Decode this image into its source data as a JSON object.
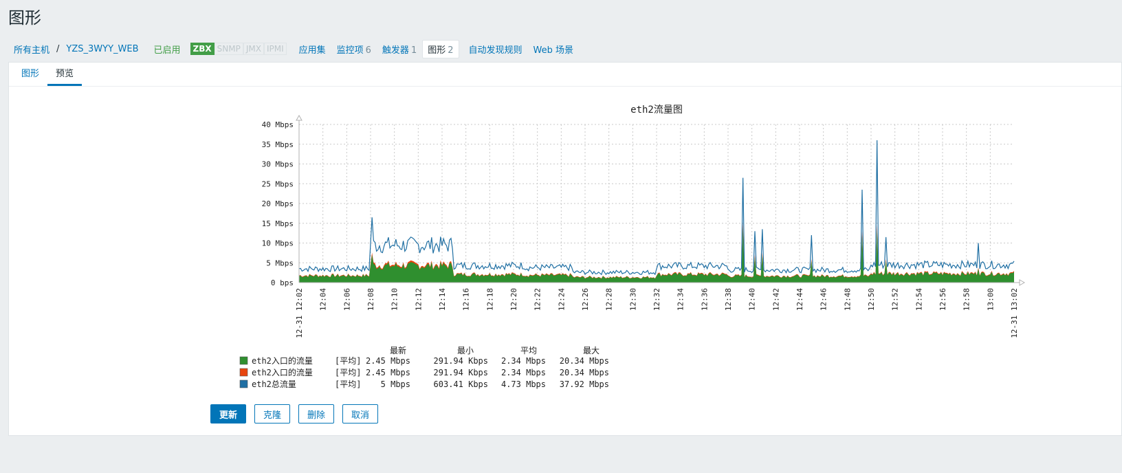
{
  "page": {
    "title": "图形"
  },
  "host_nav": {
    "all_hosts": "所有主机",
    "separator": "/",
    "host_name": "YZS_3WYY_WEB",
    "status": "已启用",
    "badges": [
      {
        "label": "ZBX",
        "active": true
      },
      {
        "label": "SNMP",
        "active": false
      },
      {
        "label": "JMX",
        "active": false
      },
      {
        "label": "IPMI",
        "active": false
      }
    ],
    "applications": "应用集",
    "items": {
      "label": "监控项",
      "count": "6"
    },
    "triggers": {
      "label": "触发器",
      "count": "1"
    },
    "graphs": {
      "label": "图形",
      "count": "2"
    },
    "discovery": "自动发现规则",
    "web": "Web 场景"
  },
  "tabs": [
    {
      "label": "图形",
      "active": false
    },
    {
      "label": "预览",
      "active": true
    }
  ],
  "buttons": {
    "update": "更新",
    "clone": "克隆",
    "delete": "删除",
    "cancel": "取消"
  },
  "chart_data": {
    "type": "area",
    "title": "eth2流量图",
    "y_ticks": [
      "0 bps",
      "5 Mbps",
      "10 Mbps",
      "15 Mbps",
      "20 Mbps",
      "25 Mbps",
      "30 Mbps",
      "35 Mbps",
      "40 Mbps"
    ],
    "ylim": [
      0,
      40
    ],
    "y_unit": "Mbps",
    "x_range_minutes": [
      0,
      60
    ],
    "x_ticks": [
      "12:04",
      "12:06",
      "12:08",
      "12:10",
      "12:12",
      "12:14",
      "12:16",
      "12:18",
      "12:20",
      "12:22",
      "12:24",
      "12:26",
      "12:28",
      "12:30",
      "12:32",
      "12:34",
      "12:36",
      "12:38",
      "12:40",
      "12:42",
      "12:44",
      "12:46",
      "12:48",
      "12:50",
      "12:52",
      "12:54",
      "12:56",
      "12:58",
      "13:00"
    ],
    "x_start_label": "12-31 12:02",
    "x_end_label": "12-31 13:02",
    "grid": true,
    "colors": {
      "in1": "#2f8f2f",
      "in2": "#e8450e",
      "total": "#1f6fa3",
      "highlight": "#e05050"
    },
    "legend_headers": [
      "最新",
      "最小",
      "平均",
      "最大"
    ],
    "series": [
      {
        "name": "eth2入口的流量",
        "func": "[平均]",
        "last": "2.45 Mbps",
        "min": "291.94 Kbps",
        "avg": "2.34 Mbps",
        "max": "20.34 Mbps",
        "color": "#2f8f2f"
      },
      {
        "name": "eth2入口的流量",
        "func": "[平均]",
        "last": "2.45 Mbps",
        "min": "291.94 Kbps",
        "avg": "2.34 Mbps",
        "max": "20.34 Mbps",
        "color": "#e8450e"
      },
      {
        "name": "eth2总流量",
        "func": "[平均]",
        "last": "5 Mbps",
        "min": "603.41 Kbps",
        "avg": "4.73 Mbps",
        "max": "37.92 Mbps",
        "color": "#1f6fa3"
      }
    ],
    "segments": [
      {
        "from": 0,
        "to": 6,
        "total": 3.5,
        "inbound": 1.7
      },
      {
        "from": 6,
        "to": 13,
        "total": 9.5,
        "inbound": 4.2
      },
      {
        "from": 13,
        "to": 19,
        "total": 4.3,
        "inbound": 2.0
      },
      {
        "from": 19,
        "to": 23,
        "total": 3.8,
        "inbound": 1.8
      },
      {
        "from": 23,
        "to": 30,
        "total": 2.6,
        "inbound": 1.3
      },
      {
        "from": 30,
        "to": 36,
        "total": 4.2,
        "inbound": 2.0
      },
      {
        "from": 36,
        "to": 48,
        "total": 3.2,
        "inbound": 1.6
      },
      {
        "from": 48,
        "to": 60,
        "total": 4.5,
        "inbound": 2.2
      }
    ],
    "spikes": [
      {
        "x": 6.1,
        "total": 16.5,
        "inbound": 7.0
      },
      {
        "x": 37.3,
        "total": 26.5,
        "inbound": 14.0
      },
      {
        "x": 38.3,
        "total": 13.0,
        "inbound": 6.5
      },
      {
        "x": 38.9,
        "total": 13.5,
        "inbound": 7.0
      },
      {
        "x": 43.0,
        "total": 12.0,
        "inbound": 5.5
      },
      {
        "x": 47.2,
        "total": 12.5,
        "inbound": 5.0
      },
      {
        "x": 47.3,
        "total": 23.5,
        "inbound": 12.0
      },
      {
        "x": 48.5,
        "total": 36.0,
        "inbound": 13.5
      },
      {
        "x": 49.2,
        "total": 11.5,
        "inbound": 5.5
      },
      {
        "x": 57.0,
        "total": 10.0,
        "inbound": 3.5
      }
    ]
  }
}
